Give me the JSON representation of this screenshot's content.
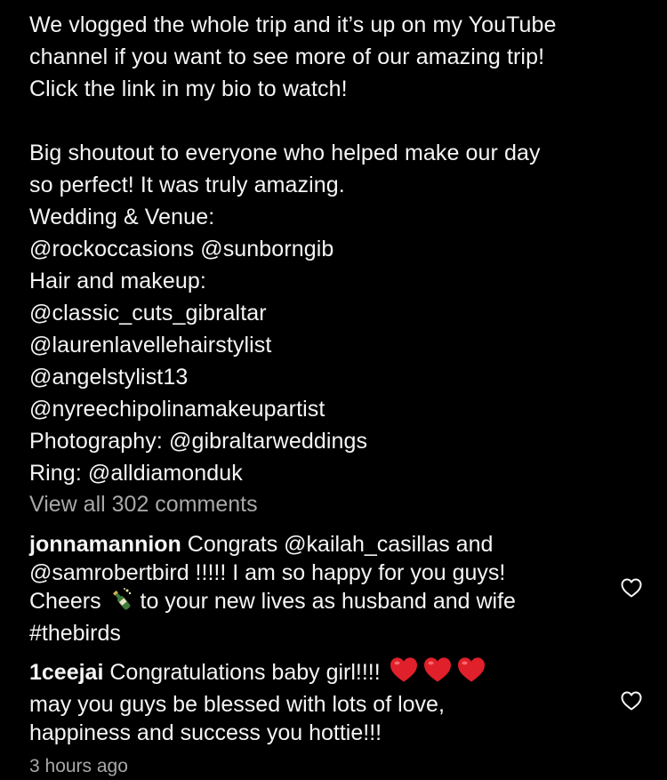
{
  "caption": {
    "lines": [
      "We vlogged the whole trip and it’s up on my YouTube",
      "channel if you want to see more of our amazing trip!",
      "Click the link in my bio to watch!",
      "Big shoutout to everyone who helped make our day",
      "so perfect! It was truly amazing.",
      "Wedding & Venue:",
      "@rockoccasions @sunborngib",
      "Hair and makeup:",
      "@classic_cuts_gibraltar",
      "@laurenlavellehairstylist",
      "@angelstylist13",
      "@nyreechipolinamakeupartist",
      "Photography: @gibraltarweddings",
      "Ring: @alldiamonduk"
    ]
  },
  "view_all_comments": "View all 302 comments",
  "comments": [
    {
      "username": "jonnamannion",
      "line1_text": " Congrats @kailah_casillas and",
      "line2": "@samrobertbird !!!!! I am so happy for you guys!",
      "line3_before": "Cheers ",
      "line3_emoji": "bottle-with-popping-cork-icon",
      "line3_after": " to your new lives as husband and wife",
      "line4": "#thebirds"
    },
    {
      "username": "1ceejai",
      "line1_text": " Congratulations baby girl!!!! ",
      "line1_emoji": "red-heart-icon",
      "line2": "may you guys be blessed with lots of love,",
      "line3": "happiness and success you hottie!!!"
    }
  ],
  "timestamp": "3 hours ago",
  "colors": {
    "background": "#000000",
    "text": "#f5f5f5",
    "secondary": "#a8a8a8",
    "heart_red": "#e0202a"
  }
}
